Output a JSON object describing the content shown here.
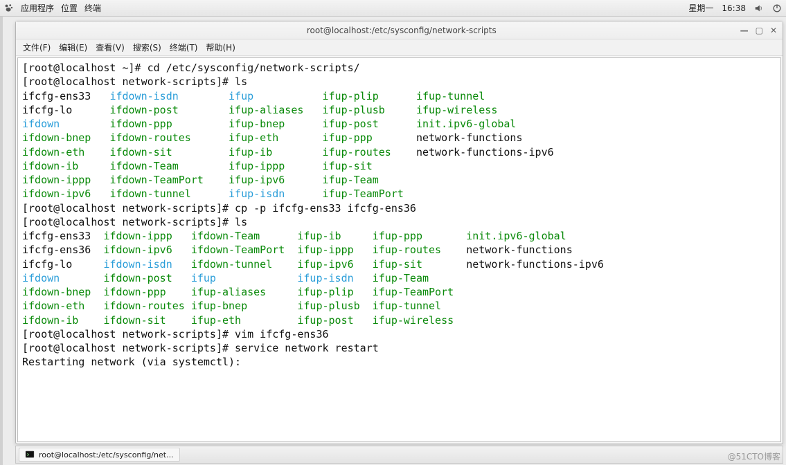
{
  "topbar": {
    "apps": "应用程序",
    "places": "位置",
    "terminal_menu": "终端",
    "day": "星期一",
    "time": "16:38"
  },
  "window": {
    "title": "root@localhost:/etc/sysconfig/network-scripts",
    "menu": {
      "file": "文件(F)",
      "edit": "编辑(E)",
      "view": "查看(V)",
      "search": "搜索(S)",
      "terminal": "终端(T)",
      "help": "帮助(H)"
    }
  },
  "terminal": {
    "prompt1": "[root@localhost ~]# ",
    "cmd1": "cd /etc/sysconfig/network-scripts/",
    "prompt2": "[root@localhost network-scripts]# ",
    "cmd2": "ls",
    "ls1": {
      "col1": [
        "ifcfg-ens33",
        "ifcfg-lo",
        "ifdown",
        "ifdown-bnep",
        "ifdown-eth",
        "ifdown-ib",
        "ifdown-ippp",
        "ifdown-ipv6"
      ],
      "col2": [
        "ifdown-isdn",
        "ifdown-post",
        "ifdown-ppp",
        "ifdown-routes",
        "ifdown-sit",
        "ifdown-Team",
        "ifdown-TeamPort",
        "ifdown-tunnel"
      ],
      "col3": [
        "ifup",
        "ifup-aliases",
        "ifup-bnep",
        "ifup-eth",
        "ifup-ib",
        "ifup-ippp",
        "ifup-ipv6",
        "ifup-isdn"
      ],
      "col4": [
        "ifup-plip",
        "ifup-plusb",
        "ifup-post",
        "ifup-ppp",
        "ifup-routes",
        "ifup-sit",
        "ifup-Team",
        "ifup-TeamPort"
      ],
      "col5": [
        "ifup-tunnel",
        "ifup-wireless",
        "init.ipv6-global",
        "network-functions",
        "network-functions-ipv6",
        "",
        "",
        ""
      ]
    },
    "cmd3": "cp -p ifcfg-ens33 ifcfg-ens36",
    "cmd4": "ls",
    "ls2": {
      "col1": [
        "ifcfg-ens33",
        "ifcfg-ens36",
        "ifcfg-lo",
        "ifdown",
        "ifdown-bnep",
        "ifdown-eth",
        "ifdown-ib"
      ],
      "col2": [
        "ifdown-ippp",
        "ifdown-ipv6",
        "ifdown-isdn",
        "ifdown-post",
        "ifdown-ppp",
        "ifdown-routes",
        "ifdown-sit"
      ],
      "col3": [
        "ifdown-Team",
        "ifdown-TeamPort",
        "ifdown-tunnel",
        "ifup",
        "ifup-aliases",
        "ifup-bnep",
        "ifup-eth"
      ],
      "col4": [
        "ifup-ib",
        "ifup-ippp",
        "ifup-ipv6",
        "ifup-isdn",
        "ifup-plip",
        "ifup-plusb",
        "ifup-post"
      ],
      "col5": [
        "ifup-ppp",
        "ifup-routes",
        "ifup-sit",
        "ifup-Team",
        "ifup-TeamPort",
        "ifup-tunnel",
        "ifup-wireless"
      ],
      "col6": [
        "init.ipv6-global",
        "network-functions",
        "network-functions-ipv6",
        "",
        "",
        "",
        ""
      ]
    },
    "cmd5": "vim ifcfg-ens36",
    "cmd6": "service network restart",
    "out6": "Restarting network (via systemctl):"
  },
  "taskbar": {
    "item": "root@localhost:/etc/sysconfig/net..."
  },
  "watermark": "@51CTO博客"
}
